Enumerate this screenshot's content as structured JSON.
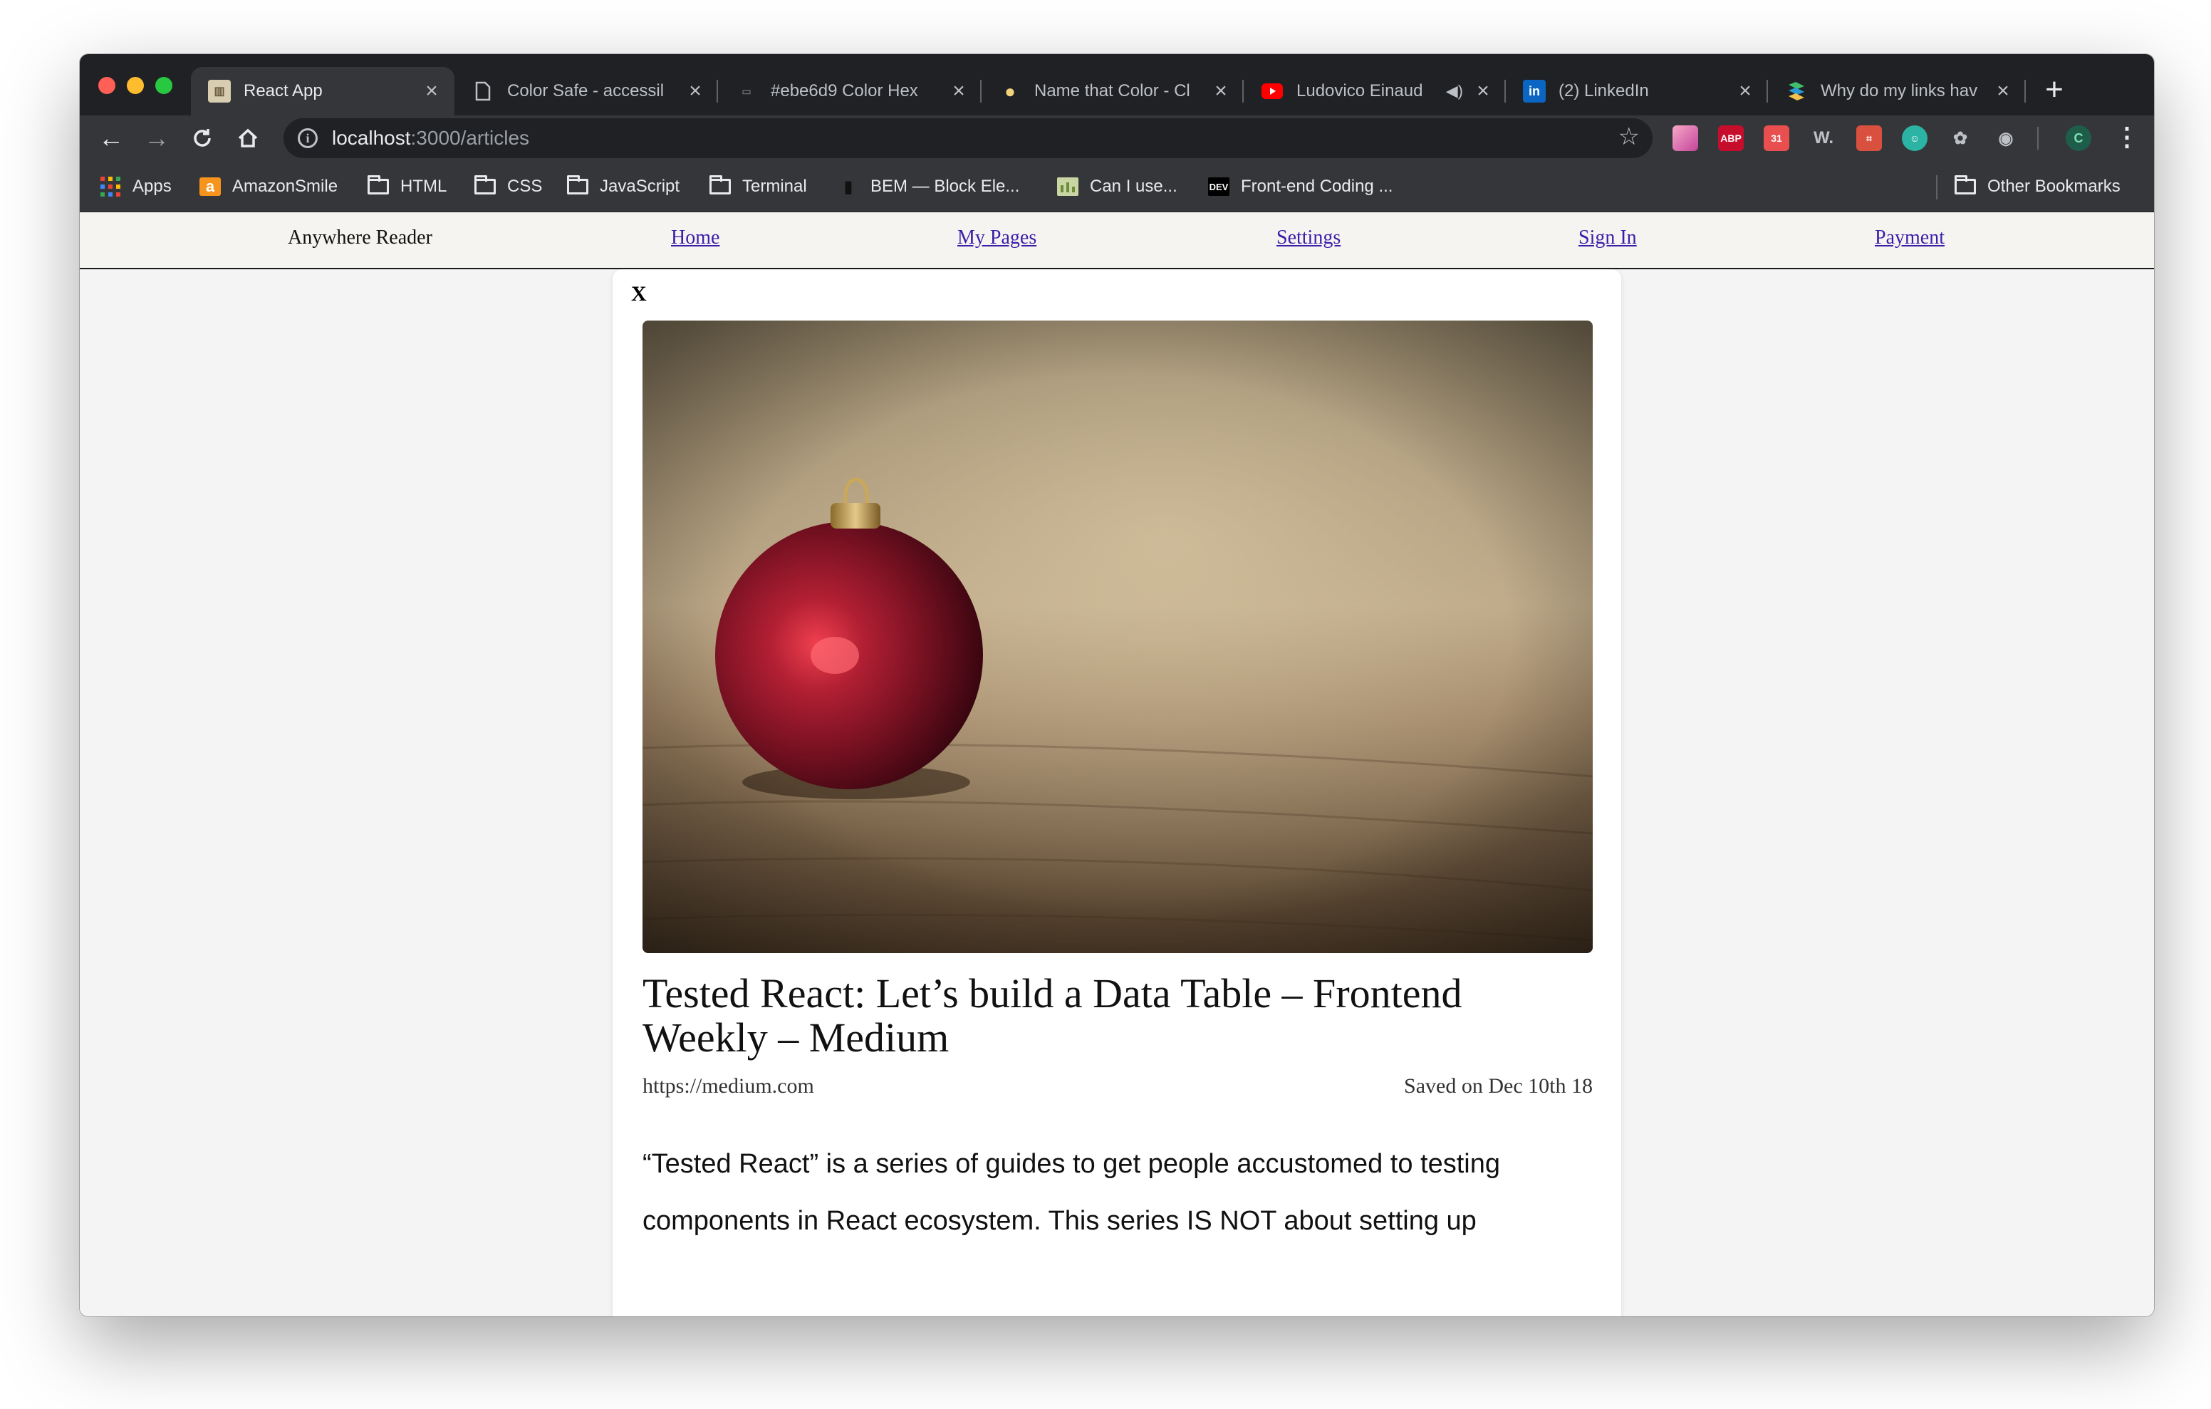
{
  "browser": {
    "tabs": [
      {
        "label": "React App",
        "active": true
      },
      {
        "label": "Color Safe - accessil",
        "active": false
      },
      {
        "label": "#ebe6d9 Color Hex",
        "active": false
      },
      {
        "label": "Name that Color - Cl",
        "active": false
      },
      {
        "label": "Ludovico Einaud",
        "active": false
      },
      {
        "label": "(2) LinkedIn",
        "active": false
      },
      {
        "label": "Why do my links hav",
        "active": false
      }
    ],
    "tab_close_glyph": "×",
    "new_tab_glyph": "+",
    "address": {
      "host": "localhost",
      "path": ":3000/articles"
    },
    "bookmarks": [
      {
        "label": "Apps",
        "icon": "apps-grid-icon"
      },
      {
        "label": "AmazonSmile",
        "icon": "amazon-icon"
      },
      {
        "label": "HTML",
        "icon": "folder-icon"
      },
      {
        "label": "CSS",
        "icon": "folder-icon"
      },
      {
        "label": "JavaScript",
        "icon": "folder-icon"
      },
      {
        "label": "Terminal",
        "icon": "folder-icon"
      },
      {
        "label": "BEM — Block Ele...",
        "icon": "page-icon"
      },
      {
        "label": "Can I use...",
        "icon": "caniuse-icon"
      },
      {
        "label": "Front-end Coding ...",
        "icon": "dev-icon"
      }
    ],
    "other_bookmarks": "Other Bookmarks",
    "extensions": [
      {
        "name": "gradient-icon",
        "text": "",
        "color": "#e25fa7"
      },
      {
        "name": "adblock-plus-icon",
        "text": "ABP",
        "color": "#c70d2c"
      },
      {
        "name": "calendar-icon",
        "text": "31",
        "color": "#e94f4f"
      },
      {
        "name": "wappalyzer-icon",
        "text": "W.",
        "color": "#35363a"
      },
      {
        "name": "dimensions-icon",
        "text": "⌗",
        "color": "#d9503f"
      },
      {
        "name": "user-circle-icon",
        "text": "☺",
        "color": "#2bb3a3"
      },
      {
        "name": "color-wheel-icon",
        "text": "✿",
        "color": "#35363a"
      },
      {
        "name": "ring-icon",
        "text": "◉",
        "color": "#35363a"
      },
      {
        "name": "profile-icon",
        "text": "C",
        "color": "#1e5d4a"
      }
    ],
    "accent_color": "#202124"
  },
  "app": {
    "brand": "Anywhere Reader",
    "nav": [
      "Home",
      "My Pages",
      "Settings",
      "Sign In",
      "Payment"
    ]
  },
  "article": {
    "close": "X",
    "title": "Tested React: Let’s build a Data Table – Frontend Weekly – Medium",
    "source": "https://medium.com",
    "saved": "Saved on Dec 10th 18",
    "excerpt": "“Tested React” is a series of guides to get people accustomed to testing components in React ecosystem. This series IS NOT about setting up",
    "image": "red-christmas-ornament-photo"
  }
}
